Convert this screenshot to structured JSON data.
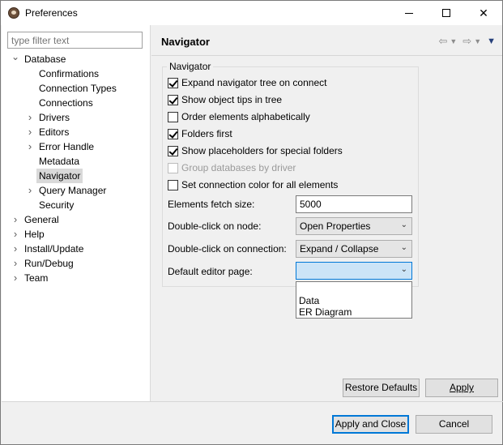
{
  "window": {
    "title": "Preferences",
    "minimize": "minimize",
    "maximize": "maximize",
    "close": "✕"
  },
  "left": {
    "filter_placeholder": "type filter text",
    "tree": [
      {
        "label": "Database",
        "level": 0,
        "twisty": "expanded"
      },
      {
        "label": "Confirmations",
        "level": 1,
        "twisty": "none"
      },
      {
        "label": "Connection Types",
        "level": 1,
        "twisty": "none"
      },
      {
        "label": "Connections",
        "level": 1,
        "twisty": "none"
      },
      {
        "label": "Drivers",
        "level": 1,
        "twisty": "collapsed"
      },
      {
        "label": "Editors",
        "level": 1,
        "twisty": "collapsed"
      },
      {
        "label": "Error Handle",
        "level": 1,
        "twisty": "collapsed"
      },
      {
        "label": "Metadata",
        "level": 1,
        "twisty": "none"
      },
      {
        "label": "Navigator",
        "level": 1,
        "twisty": "none",
        "selected": true
      },
      {
        "label": "Query Manager",
        "level": 1,
        "twisty": "collapsed"
      },
      {
        "label": "Security",
        "level": 1,
        "twisty": "none"
      },
      {
        "label": "General",
        "level": 0,
        "twisty": "collapsed"
      },
      {
        "label": "Help",
        "level": 0,
        "twisty": "collapsed"
      },
      {
        "label": "Install/Update",
        "level": 0,
        "twisty": "collapsed"
      },
      {
        "label": "Run/Debug",
        "level": 0,
        "twisty": "collapsed"
      },
      {
        "label": "Team",
        "level": 0,
        "twisty": "collapsed"
      }
    ]
  },
  "page": {
    "title": "Navigator",
    "group_label": "Navigator",
    "checkboxes": [
      {
        "label": "Expand navigator tree on connect",
        "checked": true,
        "disabled": false
      },
      {
        "label": "Show object tips in tree",
        "checked": true,
        "disabled": false
      },
      {
        "label": "Order elements alphabetically",
        "checked": false,
        "disabled": false
      },
      {
        "label": "Folders first",
        "checked": true,
        "disabled": false
      },
      {
        "label": "Show placeholders for special folders",
        "checked": true,
        "disabled": false
      },
      {
        "label": "Group databases by driver",
        "checked": false,
        "disabled": true
      },
      {
        "label": "Set connection color for all elements",
        "checked": false,
        "disabled": false
      }
    ],
    "fetch_size_label": "Elements fetch size:",
    "fetch_size_value": "5000",
    "dblclick_node_label": "Double-click on node:",
    "dblclick_node_value": "Open Properties",
    "dblclick_conn_label": "Double-click on connection:",
    "dblclick_conn_value": "Expand / Collapse",
    "default_editor_label": "Default editor page:",
    "default_editor_value": "",
    "default_editor_options": [
      "",
      "Data",
      "ER Diagram"
    ],
    "restore_defaults": "Restore Defaults",
    "apply": "Apply"
  },
  "footer": {
    "apply_close": "Apply and Close",
    "cancel": "Cancel"
  }
}
